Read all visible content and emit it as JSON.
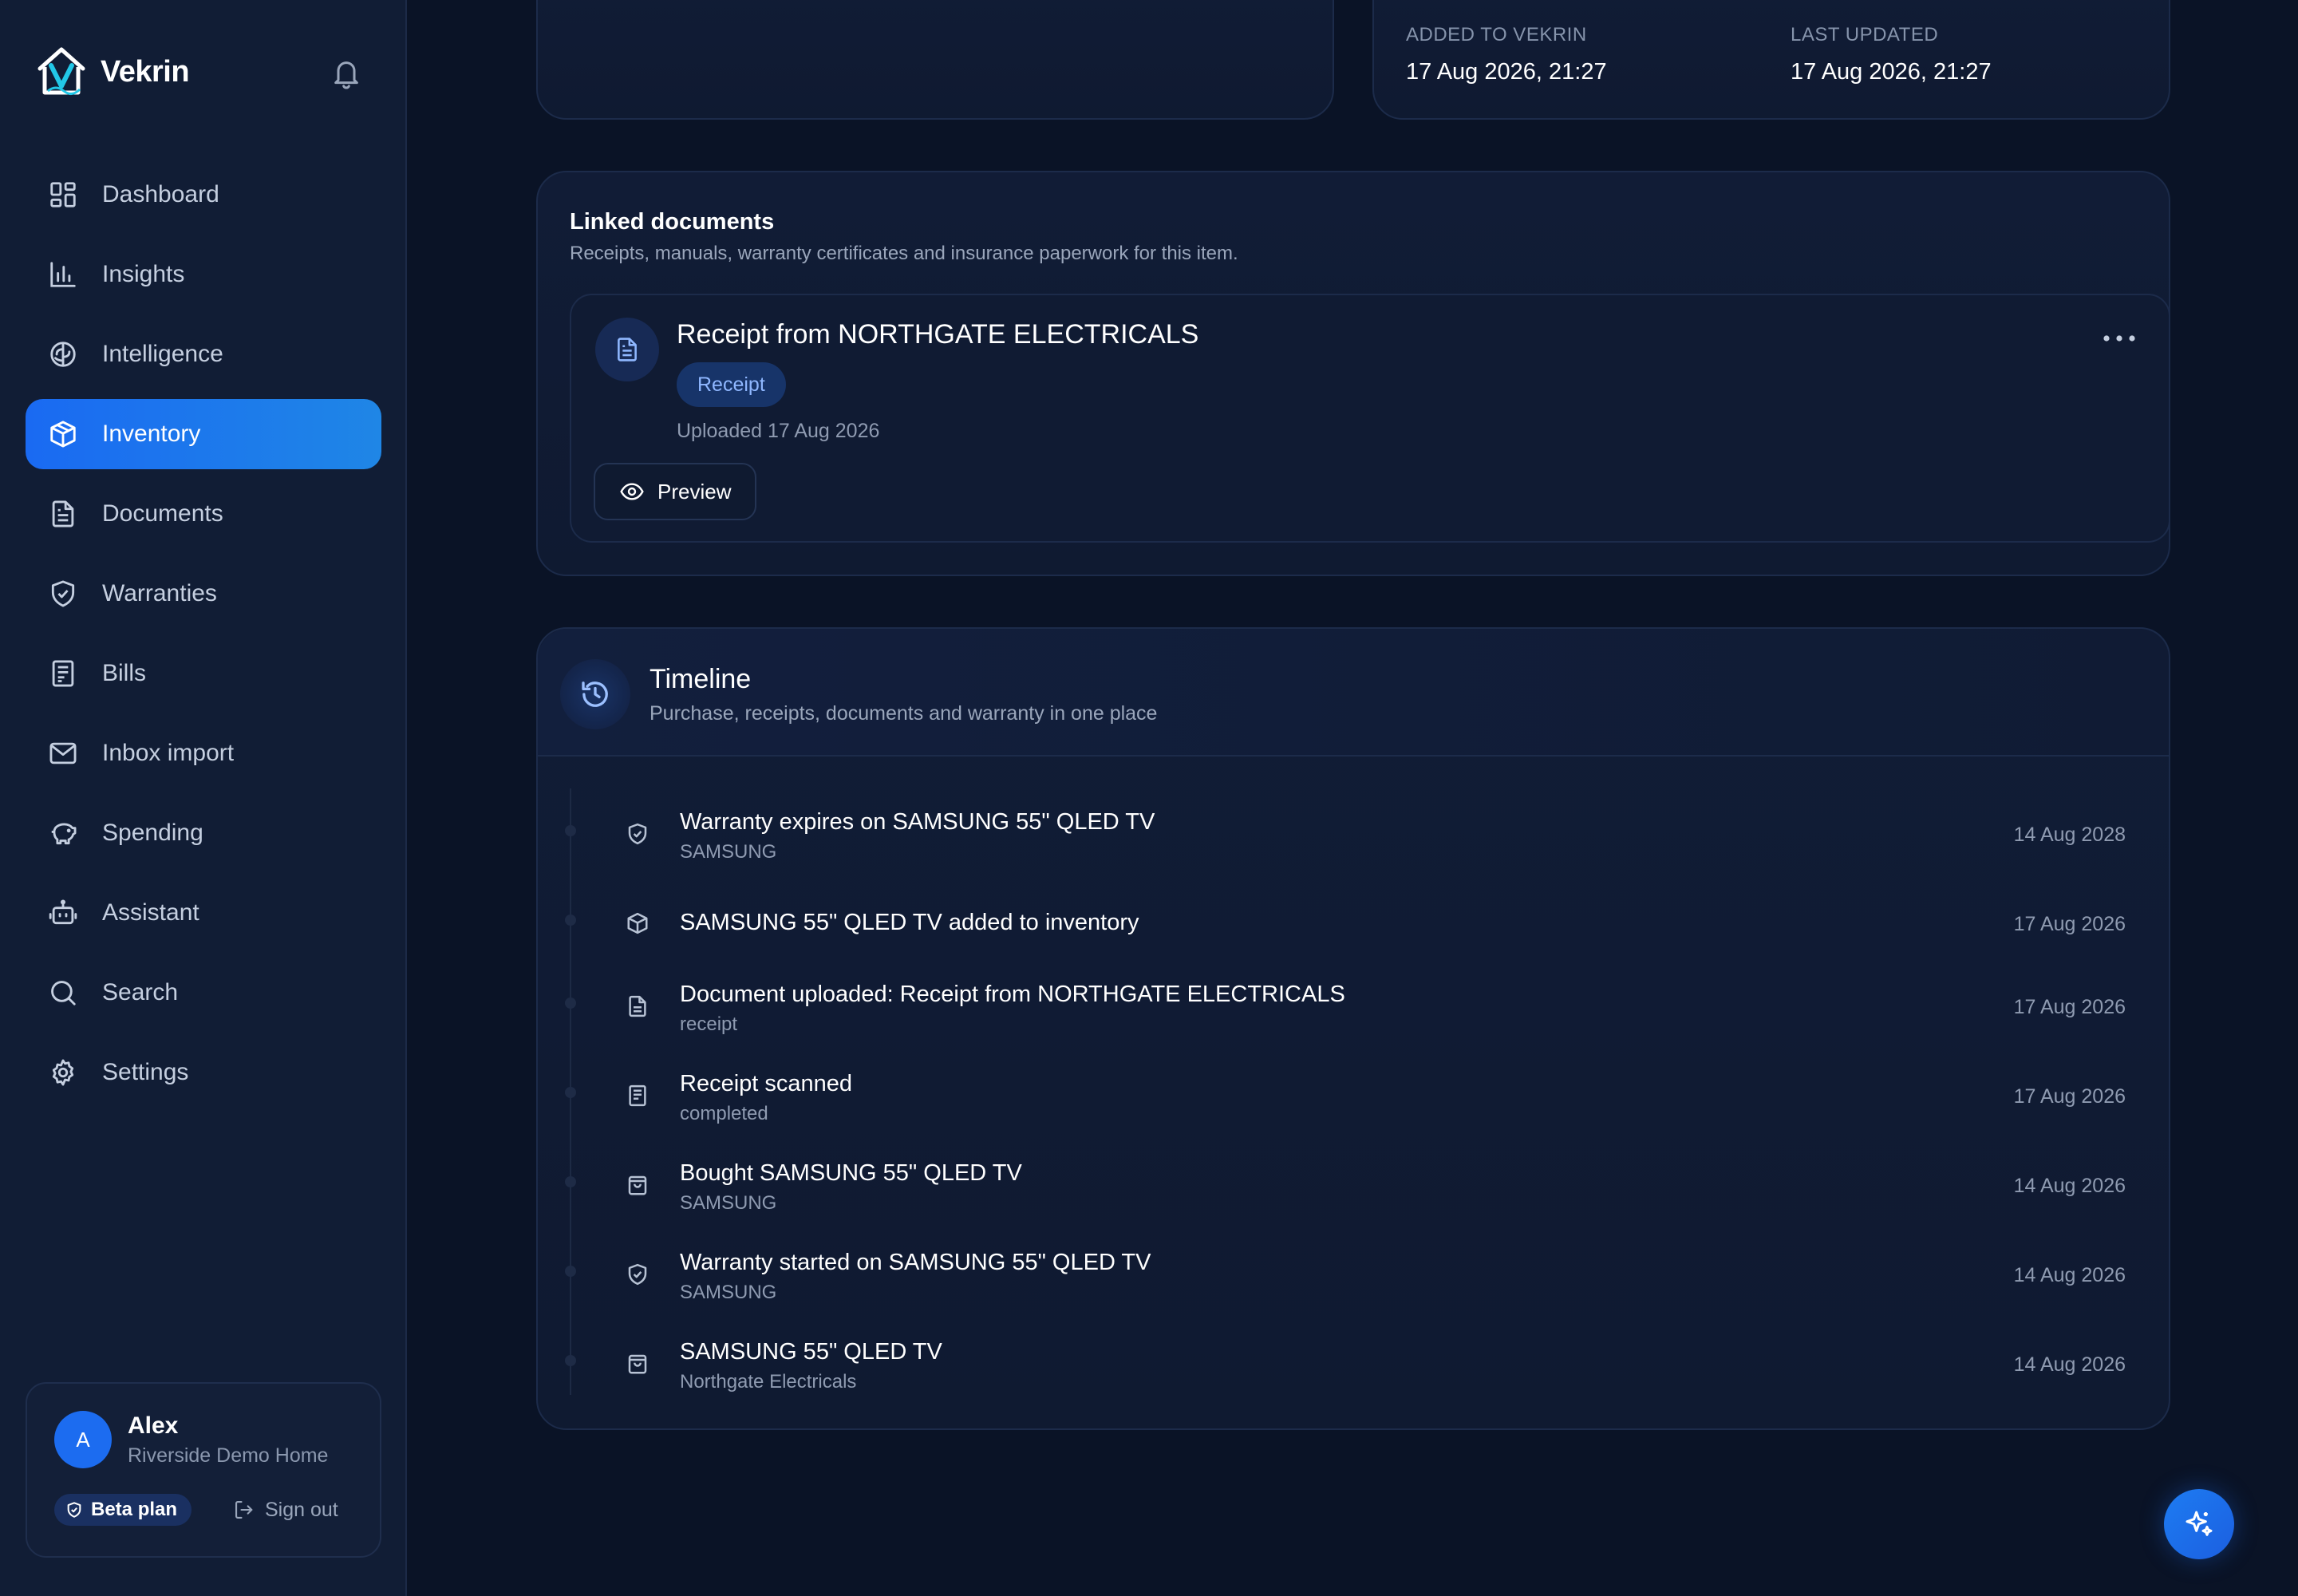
{
  "brand": {
    "name": "Vekrin"
  },
  "nav": [
    {
      "id": "dashboard",
      "label": "Dashboard",
      "icon": "dashboard-icon",
      "active": false
    },
    {
      "id": "insights",
      "label": "Insights",
      "icon": "chart-bars-icon",
      "active": false
    },
    {
      "id": "intelligence",
      "label": "Intelligence",
      "icon": "brain-icon",
      "active": false
    },
    {
      "id": "inventory",
      "label": "Inventory",
      "icon": "box-icon",
      "active": true
    },
    {
      "id": "documents",
      "label": "Documents",
      "icon": "document-icon",
      "active": false
    },
    {
      "id": "warranties",
      "label": "Warranties",
      "icon": "shield-icon",
      "active": false
    },
    {
      "id": "bills",
      "label": "Bills",
      "icon": "bill-icon",
      "active": false
    },
    {
      "id": "inbox-import",
      "label": "Inbox import",
      "icon": "mail-icon",
      "active": false
    },
    {
      "id": "spending",
      "label": "Spending",
      "icon": "piggy-bank-icon",
      "active": false
    },
    {
      "id": "assistant",
      "label": "Assistant",
      "icon": "robot-icon",
      "active": false
    },
    {
      "id": "search",
      "label": "Search",
      "icon": "search-icon",
      "active": false
    },
    {
      "id": "settings",
      "label": "Settings",
      "icon": "gear-icon",
      "active": false
    }
  ],
  "user": {
    "initial": "A",
    "name": "Alex",
    "home": "Riverside Demo Home",
    "plan": "Beta plan",
    "signout": "Sign out"
  },
  "meta": {
    "added_label": "ADDED TO VEKRIN",
    "added_value": "17 Aug 2026, 21:27",
    "updated_label": "LAST UPDATED",
    "updated_value": "17 Aug 2026, 21:27"
  },
  "linked_documents": {
    "title": "Linked documents",
    "subtitle": "Receipts, manuals, warranty certificates and insurance paperwork for this item.",
    "doc": {
      "title": "Receipt from NORTHGATE ELECTRICALS",
      "badge": "Receipt",
      "uploaded": "Uploaded 17 Aug 2026",
      "preview_label": "Preview"
    }
  },
  "timeline": {
    "title": "Timeline",
    "subtitle": "Purchase, receipts, documents and warranty in one place",
    "events": [
      {
        "icon": "shield-icon",
        "title": "Warranty expires on SAMSUNG 55\" QLED TV",
        "detail": "SAMSUNG",
        "date": "14 Aug 2028"
      },
      {
        "icon": "box-icon",
        "title": "SAMSUNG 55\" QLED TV added to inventory",
        "detail": "",
        "date": "17 Aug 2026"
      },
      {
        "icon": "document-icon",
        "title": "Document uploaded: Receipt from NORTHGATE ELECTRICALS",
        "detail": "receipt",
        "date": "17 Aug 2026"
      },
      {
        "icon": "receipt-icon",
        "title": "Receipt scanned",
        "detail": "completed",
        "date": "17 Aug 2026"
      },
      {
        "icon": "shopping-bag-icon",
        "title": "Bought SAMSUNG 55\" QLED TV",
        "detail": "SAMSUNG",
        "date": "14 Aug 2026"
      },
      {
        "icon": "shield-icon",
        "title": "Warranty started on SAMSUNG 55\" QLED TV",
        "detail": "SAMSUNG",
        "date": "14 Aug 2026"
      },
      {
        "icon": "shopping-bag-icon",
        "title": "SAMSUNG 55\" QLED TV",
        "detail": "Northgate Electricals",
        "date": "14 Aug 2026"
      }
    ]
  },
  "colors": {
    "background": "#0a1326",
    "sidebar": "#111d35",
    "accent": "#1a6af2",
    "badge_text": "#8fb7ff"
  }
}
